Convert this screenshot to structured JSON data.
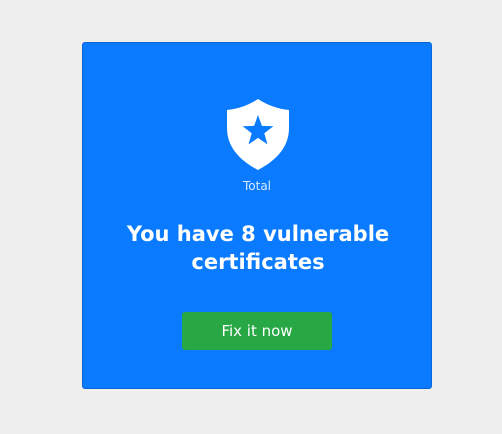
{
  "card": {
    "background_color": "#0a7bff",
    "icon": "shield-star-icon",
    "caption": "Total",
    "headline": "You have 8 vulnerable certificates",
    "button_label": "Fix it now",
    "button_color": "#28a745"
  }
}
